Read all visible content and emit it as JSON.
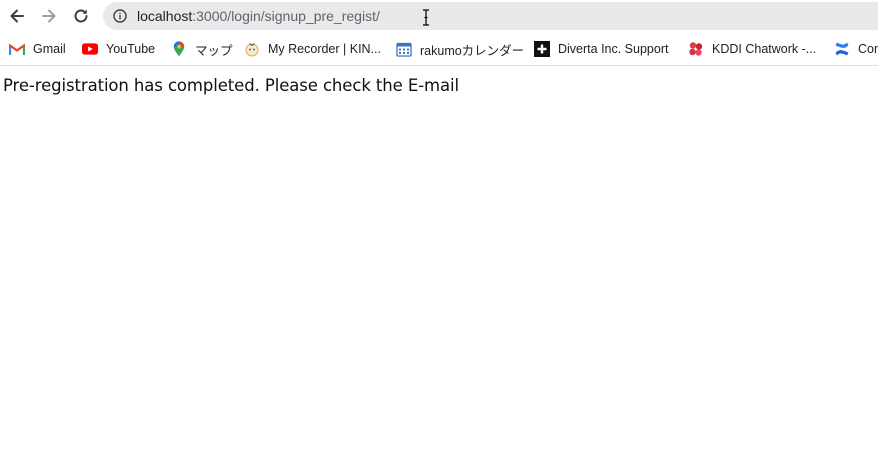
{
  "browser": {
    "url_host": "localhost",
    "url_path": ":3000/login/signup_pre_regist/"
  },
  "bookmarks": [
    {
      "label": "Gmail",
      "icon": "gmail-icon"
    },
    {
      "label": "YouTube",
      "icon": "youtube-icon"
    },
    {
      "label": "マップ",
      "icon": "maps-icon"
    },
    {
      "label": "My Recorder | KIN...",
      "icon": "recorder-icon"
    },
    {
      "label": "rakumoカレンダー",
      "icon": "calendar-icon"
    },
    {
      "label": "Diverta Inc. Support",
      "icon": "diverta-icon"
    },
    {
      "label": "KDDI Chatwork -...",
      "icon": "chatwork-icon"
    },
    {
      "label": "Con",
      "icon": "confluence-icon"
    }
  ],
  "page": {
    "message": "Pre-registration has completed. Please check the E-mail"
  },
  "colors": {
    "omnibox_bg": "#e9e9eb",
    "youtube_red": "#ff0000",
    "confluence_blue": "#1868db"
  }
}
